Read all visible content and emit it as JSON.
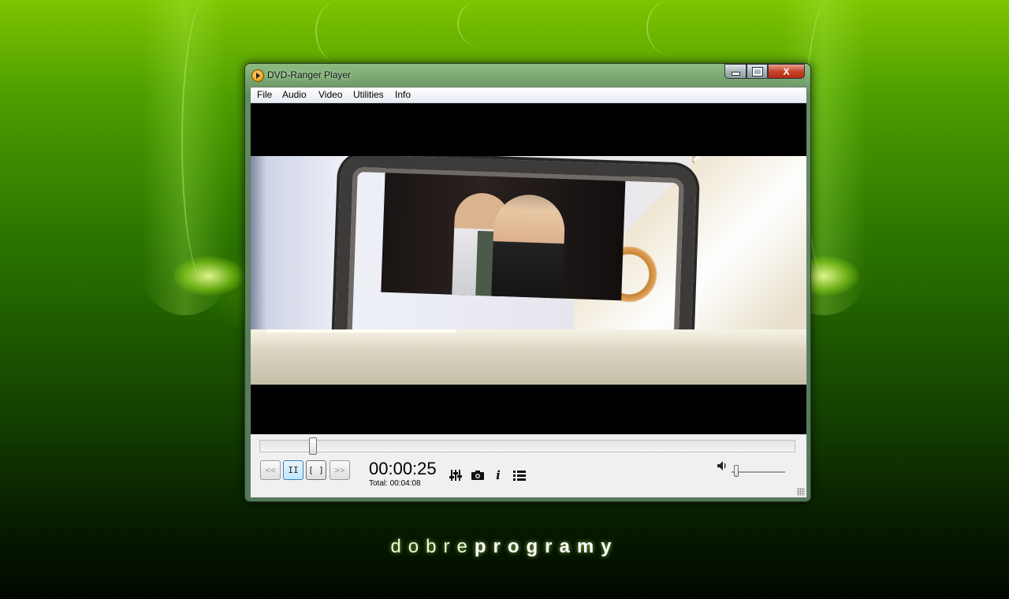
{
  "window": {
    "title": "DVD-Ranger Player",
    "close_glyph": "X"
  },
  "menu": {
    "items": [
      {
        "label": "File"
      },
      {
        "label": "Audio"
      },
      {
        "label": "Video"
      },
      {
        "label": "Utilities"
      },
      {
        "label": "Info"
      }
    ]
  },
  "player": {
    "seek_progress": 0.1,
    "volume_level": 0.0,
    "buttons": {
      "prev_label": "<<",
      "pause_label": "II",
      "stop_label": "[ ]",
      "next_label": ">>"
    },
    "current_time": "00:00:25",
    "total_time": "Total: 00:04:08",
    "tools": {
      "info_glyph": "i"
    }
  },
  "desktop": {
    "brand_part1": "dobre",
    "brand_part2": "programy"
  },
  "colors": {
    "background_green": "#2c7500",
    "close_red": "#c8452a",
    "active_button_blue": "#bee6fd"
  },
  "icons": [
    "app-logo-icon",
    "minimize-icon",
    "maximize-icon",
    "close-icon",
    "equalizer-icon",
    "camera-icon",
    "info-icon",
    "playlist-icon",
    "speaker-icon"
  ]
}
